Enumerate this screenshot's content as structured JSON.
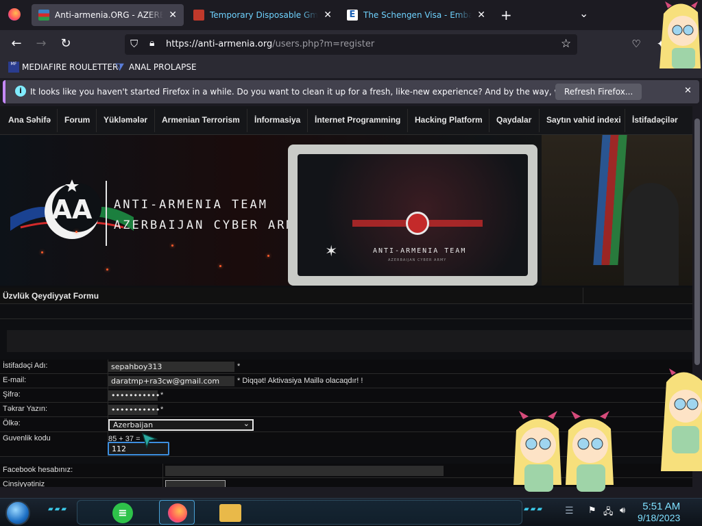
{
  "browser": {
    "tabs": [
      {
        "title": "Anti-armenia.ORG - AZERBAIJAN",
        "active": true,
        "favicon_color": "#3b82c4"
      },
      {
        "title": "Temporary Disposable Gmail | T",
        "active": false,
        "favicon_color": "#c0392b"
      },
      {
        "title": "The Schengen Visa - Embassy.s",
        "active": false,
        "favicon_color": "#ffffff"
      }
    ],
    "url_host": "https://anti-armenia.org",
    "url_path": "/users.php?m=register",
    "bookmarks": [
      {
        "label": "MEDIAFIRE ROULETTER"
      },
      {
        "label": "ANAL PROLAPSE"
      }
    ],
    "notification": {
      "message": "It looks like you haven't started Firefox in a while. Do you want to clean it up for a fresh, like-new experience? And by the way, welcome back!",
      "button": "Refresh Firefox..."
    }
  },
  "site": {
    "menu": [
      "Ana Səhifə",
      "Forum",
      "Yükləmələr",
      "Armenian Terrorism",
      "İnformasiya",
      "İnternet Programming",
      "Hacking Platform",
      "Qaydalar",
      "Saytın vahid indexi",
      "İstifadəçilər"
    ],
    "banner": {
      "line1": "ANTI-ARMENIA TEAM",
      "line2": "AZERBAIJAN CYBER ARMY",
      "screen_text": "ANTI-ARMENIA TEAM",
      "screen_sub": "AZERBAIJAN CYBER ARMY"
    },
    "form_title": "Üzvlük Qeydiyyat Formu",
    "fields": {
      "username": {
        "label": "İstifadəçi Adı:",
        "value": "sepahboy313",
        "note": "*"
      },
      "email": {
        "label": "E-mail:",
        "value": "daratmp+ra3cw@gmail.com",
        "note": "* Diqqət! Aktivasiya Maillə olacaqdır! !"
      },
      "password": {
        "label": "Şifrə:",
        "value": "•••••••••••",
        "note": "*"
      },
      "password_repeat": {
        "label": "Təkrar Yazın:",
        "value": "•••••••••••",
        "note": "*"
      },
      "country": {
        "label": "Ölkə:",
        "value": "Azerbaijan"
      },
      "captcha": {
        "label": "Guvenlik kodu",
        "question": "85 + 37 =",
        "value": "112"
      },
      "facebook": {
        "label": "Facebook hesabınız:"
      },
      "gender": {
        "label": "Cinsiyyətiniz"
      }
    }
  },
  "taskbar": {
    "time": "5:51 AM",
    "date": "9/18/2023"
  }
}
